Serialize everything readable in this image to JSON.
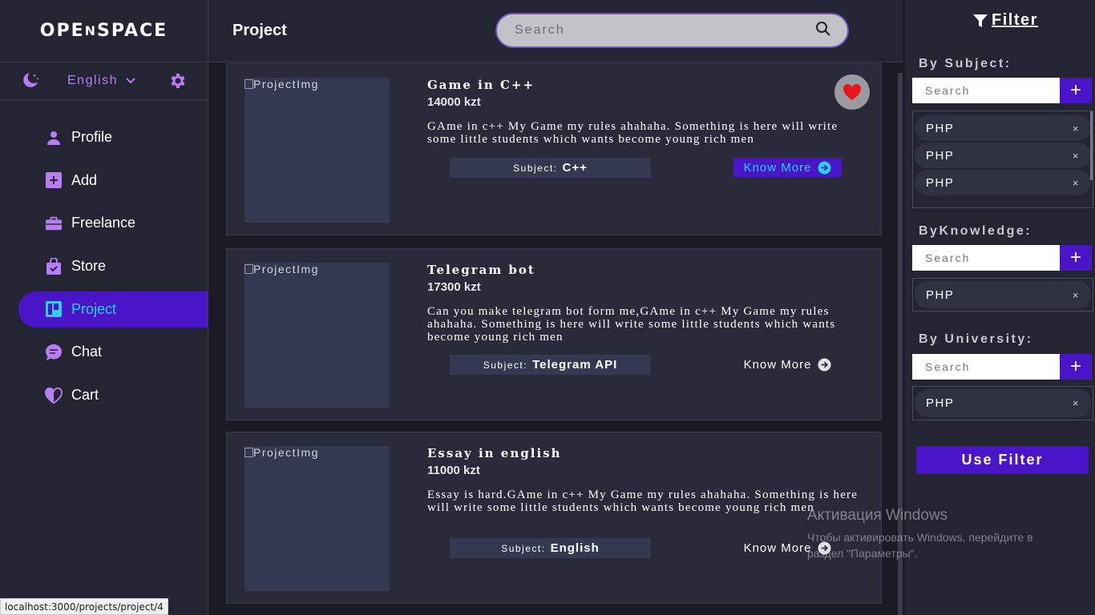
{
  "sidebar": {
    "logo": {
      "p1": "OPE",
      "p2": "N",
      "p3": "SPACE"
    },
    "language": "English",
    "items": [
      {
        "label": "Profile",
        "icon": "user-icon"
      },
      {
        "label": "Add",
        "icon": "plus-square-icon"
      },
      {
        "label": "Freelance",
        "icon": "briefcase-icon"
      },
      {
        "label": "Store",
        "icon": "shopping-bag-icon"
      },
      {
        "label": "Project",
        "icon": "kanban-icon",
        "active": true
      },
      {
        "label": "Chat",
        "icon": "chat-icon"
      },
      {
        "label": "Cart",
        "icon": "heart-half-icon"
      }
    ]
  },
  "header": {
    "title": "Project",
    "search_placeholder": "Search"
  },
  "projects": [
    {
      "img_alt": "ProjectImg",
      "title": "Game in C++",
      "price": "14000 kzt",
      "description": "GAme in c++ My Game my rules ahahaha. Something is here will write some little students which wants become young rich men",
      "subject_label": "Subject:",
      "subject": "C++",
      "know_more": "Know More",
      "favorited": true
    },
    {
      "img_alt": "ProjectImg",
      "title": "Telegram bot",
      "price": "17300 kzt",
      "description": "Can you make telegram bot form me,GAme in c++ My Game my rules ahahaha. Something is here will write some little students which wants become young rich men",
      "subject_label": "Subject:",
      "subject": "Telegram API",
      "know_more": "Know More",
      "favorited": false
    },
    {
      "img_alt": "ProjectImg",
      "title": "Essay in english",
      "price": "11000 kzt",
      "description": "Essay is hard.GAme in c++ My Game my rules ahahaha. Something is here will write some little students which wants become young rich men",
      "subject_label": "Subject:",
      "subject": "English",
      "know_more": "Know More",
      "favorited": false
    }
  ],
  "filter": {
    "title": "Filter",
    "sections": [
      {
        "label": "By Subject:",
        "placeholder": "Search",
        "tags": [
          "PHP",
          "PHP",
          "PHP"
        ]
      },
      {
        "label": "ByKnowledge:",
        "placeholder": "Search",
        "tags": [
          "PHP"
        ]
      },
      {
        "label": "By University:",
        "placeholder": "Search",
        "tags": [
          "PHP"
        ]
      }
    ],
    "add_symbol": "+",
    "remove_symbol": "×",
    "use_filter": "Use Filter"
  },
  "status_url": "localhost:3000/projects/project/4",
  "watermark": {
    "line1": "Активация Windows",
    "line2": "Чтобы активировать Windows, перейдите в раздел \"Параметры\"."
  },
  "colors": {
    "accent": "#4a14c9",
    "active_text": "#27d3f0",
    "icon_purple": "#b97cf5"
  }
}
